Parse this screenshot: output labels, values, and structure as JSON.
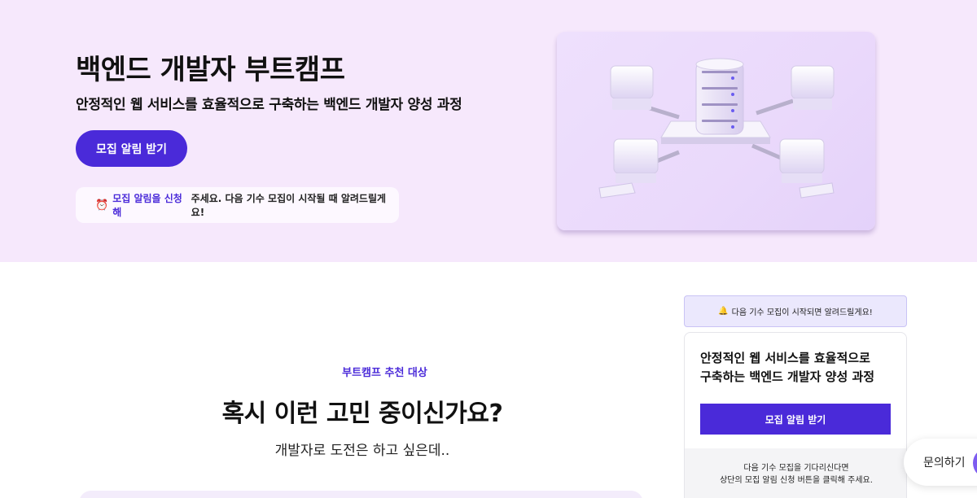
{
  "hero": {
    "title": "백엔드 개발자 부트캠프",
    "subtitle": "안정적인 웹 서비스를 효율적으로 구축하는 백엔드 개발자 양성 과정",
    "cta_label": "모집 알림 받기",
    "notice_icon": "⏰",
    "notice_highlight": "모집 알림을 신청해",
    "notice_rest": "주세요. 다음 기수 모집이 시작될 때 알려드릴게요!",
    "visual_icon": "server-network-illustration"
  },
  "section": {
    "eyebrow": "부트캠프 추천 대상",
    "title": "혹시 이런 고민 중이신가요?",
    "description": "개발자로 도전은 하고 싶은데.."
  },
  "sidebar": {
    "banner_icon": "🔔",
    "banner_text": "다음 기수 모집이 시작되면 알려드릴게요!",
    "card_title_line1": "안정적인 웹 서비스를 효율적으로",
    "card_title_line2": "구축하는 백엔드 개발자 양성 과정",
    "cta_label": "모집 알림 받기",
    "footer_line1": "다음 기수 모집을 기다리신다면",
    "footer_line2": "상단의 모집 알림 신청 버튼을 클릭해 주세요."
  },
  "contact": {
    "label": "문의하기"
  },
  "colors": {
    "brand": "#4a2ad9",
    "hero_bg": "#f6e8fc"
  }
}
